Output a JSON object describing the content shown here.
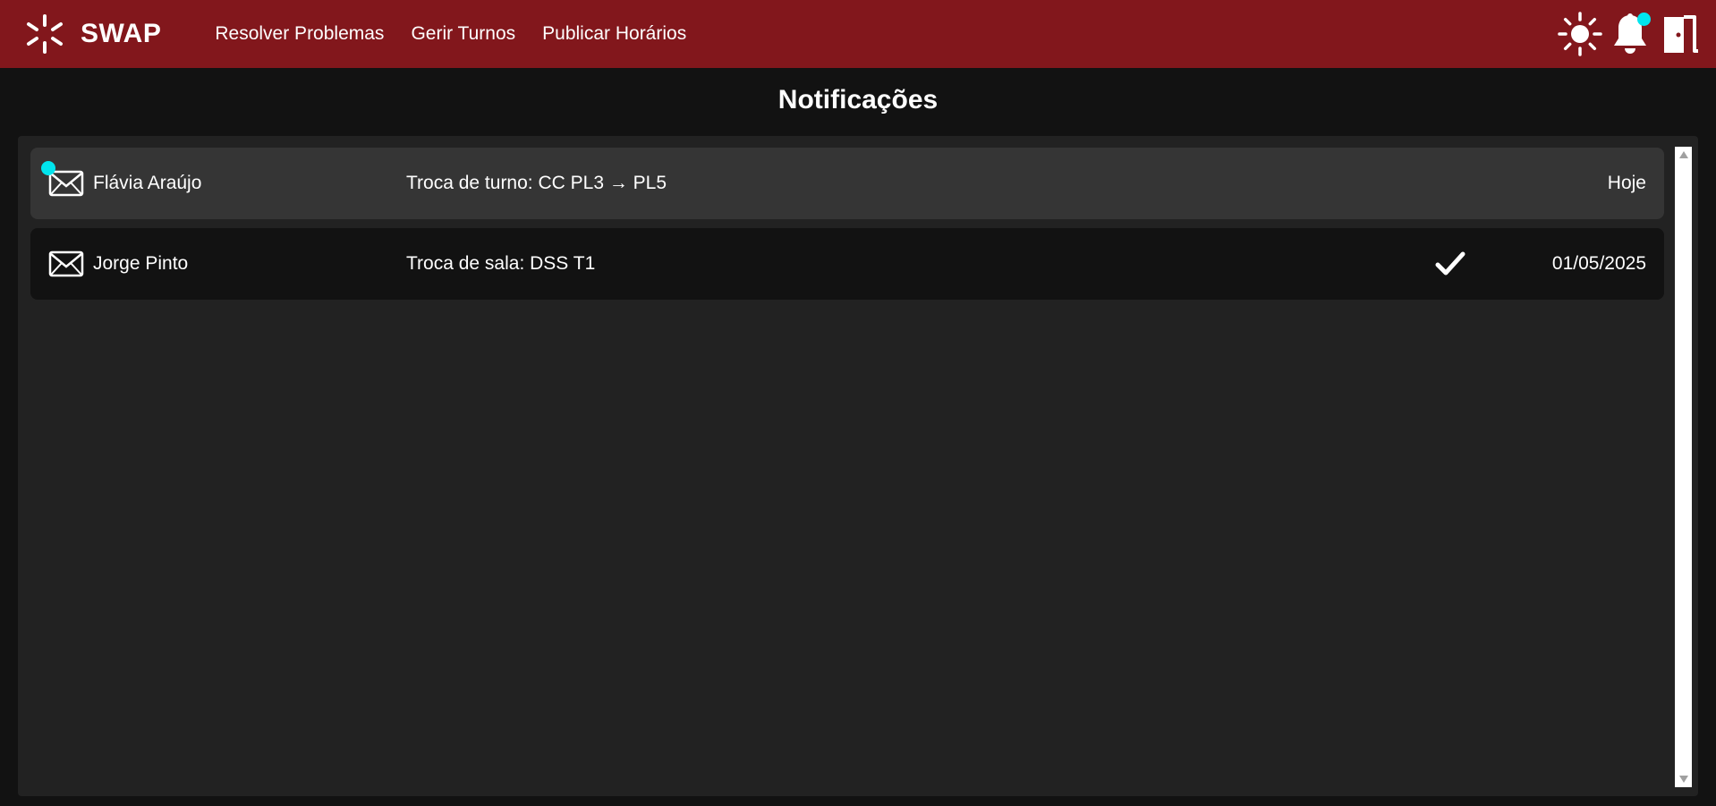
{
  "header": {
    "app_name": "SWAP",
    "logo_icon": "sunburst-logo-icon",
    "nav": [
      {
        "label": "Resolver Problemas"
      },
      {
        "label": "Gerir Turnos"
      },
      {
        "label": "Publicar Horários"
      }
    ],
    "actions": {
      "theme_icon": "sun-icon",
      "notifications_icon": "bell-icon",
      "notifications_has_new": true,
      "logout_icon": "door-exit-icon"
    },
    "colors": {
      "background": "#82171c",
      "badge": "#00e5ee"
    }
  },
  "page": {
    "title": "Notificações"
  },
  "notifications": [
    {
      "sender": "Flávia Araújo",
      "subject": "Troca de turno: CC PL3 → PL5",
      "date": "Hoje",
      "unread": true,
      "resolved": false,
      "icon": "envelope-icon"
    },
    {
      "sender": "Jorge Pinto",
      "subject": "Troca de sala: DSS T1",
      "date": "01/05/2025",
      "unread": false,
      "resolved": true,
      "icon": "envelope-icon",
      "status_icon": "checkmark-icon"
    }
  ]
}
